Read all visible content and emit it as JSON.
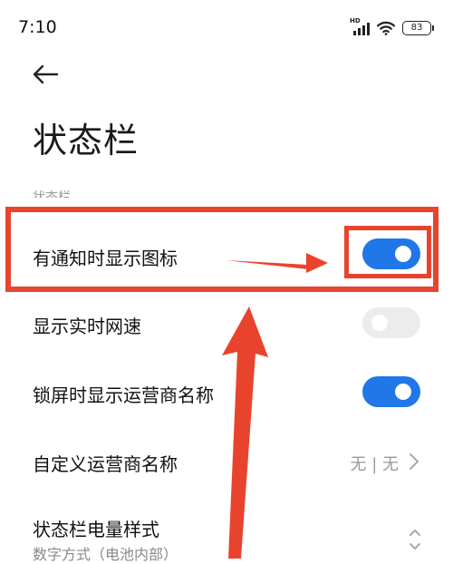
{
  "status_bar": {
    "time": "7:10",
    "network_label": "HD",
    "battery": "83"
  },
  "header": {
    "title": "状态栏"
  },
  "section": {
    "label": "状态栏"
  },
  "rows": [
    {
      "label": "有通知时显示图标",
      "control": "toggle",
      "on": true
    },
    {
      "label": "显示实时网速",
      "control": "toggle",
      "on": false
    },
    {
      "label": "锁屏时显示运营商名称",
      "control": "toggle",
      "on": true
    },
    {
      "label": "自定义运营商名称",
      "control": "value",
      "value": "无 | 无"
    },
    {
      "label": "状态栏电量样式",
      "sublabel": "数字方式（电池内部）",
      "control": "selector"
    }
  ],
  "colors": {
    "accent": "#1f77e8",
    "annotation": "#e8442d",
    "toggle_off": "#ececec"
  },
  "icons": {
    "back": "arrow-left-icon",
    "signal": "signal-icon",
    "wifi": "wifi-icon",
    "battery": "battery-icon",
    "chevron": "chevron-right-icon",
    "updown": "chevron-updown-icon"
  }
}
